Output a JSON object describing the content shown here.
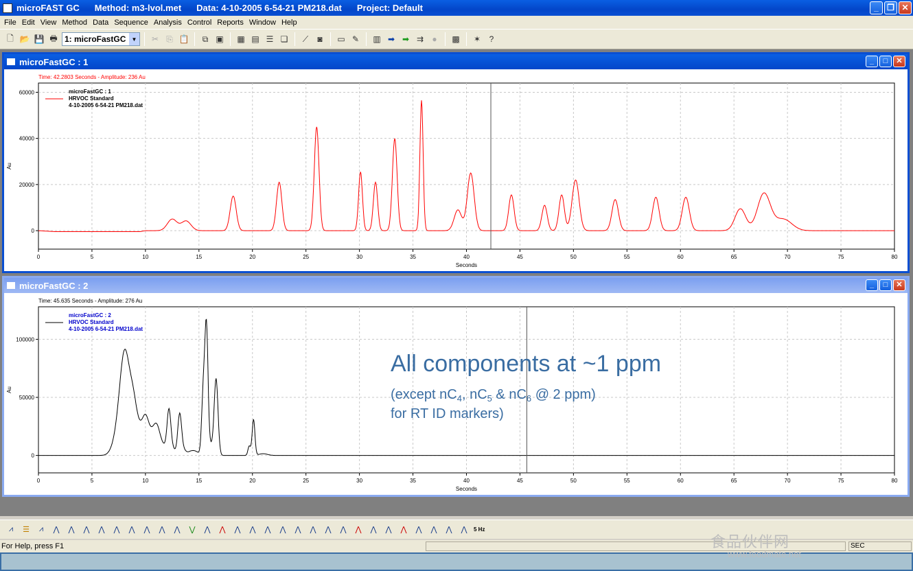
{
  "titlebar": {
    "app": "microFAST GC",
    "method": "Method:  m3-lvol.met",
    "data": "Data: 4-10-2005 6-54-21 PM218.dat",
    "project": "Project: Default"
  },
  "menu": [
    "File",
    "Edit",
    "View",
    "Method",
    "Data",
    "Sequence",
    "Analysis",
    "Control",
    "Reports",
    "Window",
    "Help"
  ],
  "toolbar": {
    "channel_select": "1: microFastGC"
  },
  "colors": {
    "trace1": "#ff0000",
    "trace2": "#000000",
    "annotation": "#3a6da2",
    "legend2_text": "#0000cc"
  },
  "windows": [
    {
      "title": "microFastGC : 1",
      "readout": "Time:  42.2803 Seconds - Amplitude:  236 Au",
      "legend": [
        "microFastGC : 1",
        "HRVOC Standard",
        "4-10-2005 6-54-21 PM218.dat"
      ]
    },
    {
      "title": "microFastGC : 2",
      "readout": "Time:  45.635 Seconds - Amplitude:  276 Au",
      "legend": [
        "microFastGC : 2",
        "HRVOC Standard",
        "4-10-2005 6-54-21 PM218.dat"
      ],
      "annotation": {
        "headline": "All components at ~1 ppm",
        "line2_a": "(except nC",
        "sub1": "4",
        "line2_b": ", nC",
        "sub2": "5",
        "line2_c": " & nC",
        "sub3": "6",
        "line2_d": " @ 2 ppm)",
        "line3": "for RT ID markers)"
      }
    }
  ],
  "chart_data": [
    {
      "type": "line",
      "xlabel": "Seconds",
      "ylabel": "Au",
      "xlim": [
        0,
        80
      ],
      "ylim": [
        -8000,
        64000
      ],
      "x_ticks": [
        0,
        5,
        10,
        15,
        20,
        25,
        30,
        35,
        40,
        45,
        50,
        55,
        60,
        65,
        70,
        75,
        80
      ],
      "y_ticks": [
        0,
        20000,
        40000,
        60000
      ],
      "cursor_x": 42.28,
      "grid": true,
      "legend_position": "top-left",
      "series": [
        {
          "name": "microFastGC : 1",
          "baseline_points": [
            [
              0,
              0
            ],
            [
              1.5,
              -400
            ],
            [
              9.5,
              -400
            ],
            [
              10,
              0
            ],
            [
              80,
              0
            ]
          ],
          "peaks": [
            [
              12.5,
              5000,
              0.45
            ],
            [
              13.8,
              4200,
              0.45
            ],
            [
              18.2,
              15000,
              0.28
            ],
            [
              22.5,
              21000,
              0.25
            ],
            [
              26.0,
              45000,
              0.22
            ],
            [
              30.1,
              25500,
              0.18
            ],
            [
              31.5,
              21000,
              0.2
            ],
            [
              33.3,
              40000,
              0.22
            ],
            [
              35.8,
              56500,
              0.15
            ],
            [
              39.2,
              9000,
              0.35
            ],
            [
              40.4,
              25000,
              0.32
            ],
            [
              44.2,
              15500,
              0.25
            ],
            [
              47.3,
              11000,
              0.25
            ],
            [
              48.9,
              15500,
              0.25
            ],
            [
              50.2,
              22000,
              0.33
            ],
            [
              53.9,
              13500,
              0.3
            ],
            [
              57.7,
              14500,
              0.3
            ],
            [
              60.5,
              14500,
              0.33
            ],
            [
              65.6,
              9500,
              0.5
            ],
            [
              67.8,
              16000,
              0.6
            ],
            [
              69.6,
              5000,
              0.8
            ]
          ]
        }
      ]
    },
    {
      "type": "line",
      "xlabel": "Seconds",
      "ylabel": "Au",
      "xlim": [
        0,
        80
      ],
      "ylim": [
        -15000,
        128000
      ],
      "x_ticks": [
        0,
        5,
        10,
        15,
        20,
        25,
        30,
        35,
        40,
        45,
        50,
        55,
        60,
        65,
        70,
        75,
        80
      ],
      "y_ticks": [
        0,
        50000,
        100000
      ],
      "cursor_x": 45.64,
      "grid": true,
      "legend_position": "top-left",
      "series": [
        {
          "name": "microFastGC : 2",
          "baseline_points": [
            [
              0,
              0
            ],
            [
              80,
              0
            ]
          ],
          "peaks": [
            [
              7.5,
              18000,
              0.5
            ],
            [
              8.1,
              80000,
              0.45
            ],
            [
              8.9,
              38000,
              0.35
            ],
            [
              9.5,
              14000,
              0.3
            ],
            [
              10.0,
              28000,
              0.3
            ],
            [
              10.6,
              16000,
              0.35
            ],
            [
              11.1,
              20000,
              0.3
            ],
            [
              11.7,
              7000,
              0.3
            ],
            [
              12.2,
              38000,
              0.18
            ],
            [
              12.6,
              5000,
              0.2
            ],
            [
              13.2,
              36000,
              0.18
            ],
            [
              13.6,
              4000,
              0.2
            ],
            [
              14.2,
              3000,
              0.3
            ],
            [
              14.7,
              3000,
              0.3
            ],
            [
              15.4,
              52000,
              0.15
            ],
            [
              15.7,
              109000,
              0.15
            ],
            [
              16.1,
              8000,
              0.2
            ],
            [
              16.6,
              66000,
              0.18
            ],
            [
              19.7,
              8000,
              0.12
            ],
            [
              20.1,
              31000,
              0.13
            ],
            [
              21.0,
              1500,
              0.4
            ]
          ]
        }
      ]
    }
  ],
  "statusbar": {
    "help": "For Help, press F1",
    "mode": "SEC"
  },
  "peak_toolbar": {
    "rate_label": "5 Hz"
  },
  "watermark": {
    "cn": "食品伙伴网",
    "url": "www.foodmate.net"
  }
}
